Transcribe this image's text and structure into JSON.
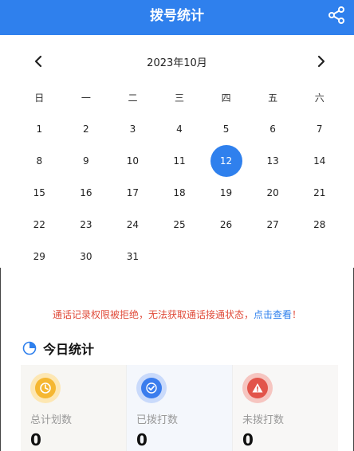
{
  "header": {
    "title": "拨号统计",
    "share_icon": "share-icon"
  },
  "calendar": {
    "month_title": "2023年10月",
    "prev_icon": "chevron-left-icon",
    "next_icon": "chevron-right-icon",
    "weekdays": [
      "日",
      "一",
      "二",
      "三",
      "四",
      "五",
      "六"
    ],
    "days": [
      "1",
      "2",
      "3",
      "4",
      "5",
      "6",
      "7",
      "8",
      "9",
      "10",
      "11",
      "12",
      "13",
      "14",
      "15",
      "16",
      "17",
      "18",
      "19",
      "20",
      "21",
      "22",
      "23",
      "24",
      "25",
      "26",
      "27",
      "28",
      "29",
      "30",
      "31"
    ],
    "selected_day": "12",
    "accent": "#2f80ed"
  },
  "warning": {
    "text": "通话记录权限被拒绝，无法获取通话接通状态，",
    "link": "点击查看",
    "suffix": "！",
    "color": "#e04b3a"
  },
  "today": {
    "title": "今日统计",
    "icon": "pie-chart-icon",
    "stats": [
      {
        "label": "总计划数",
        "value": "0",
        "icon": "clock-icon",
        "color": "#f5b731"
      },
      {
        "label": "已拨打数",
        "value": "0",
        "icon": "check-circle-icon",
        "color": "#3b7ded"
      },
      {
        "label": "未拨打数",
        "value": "0",
        "icon": "alert-icon",
        "color": "#e2544a"
      }
    ]
  }
}
